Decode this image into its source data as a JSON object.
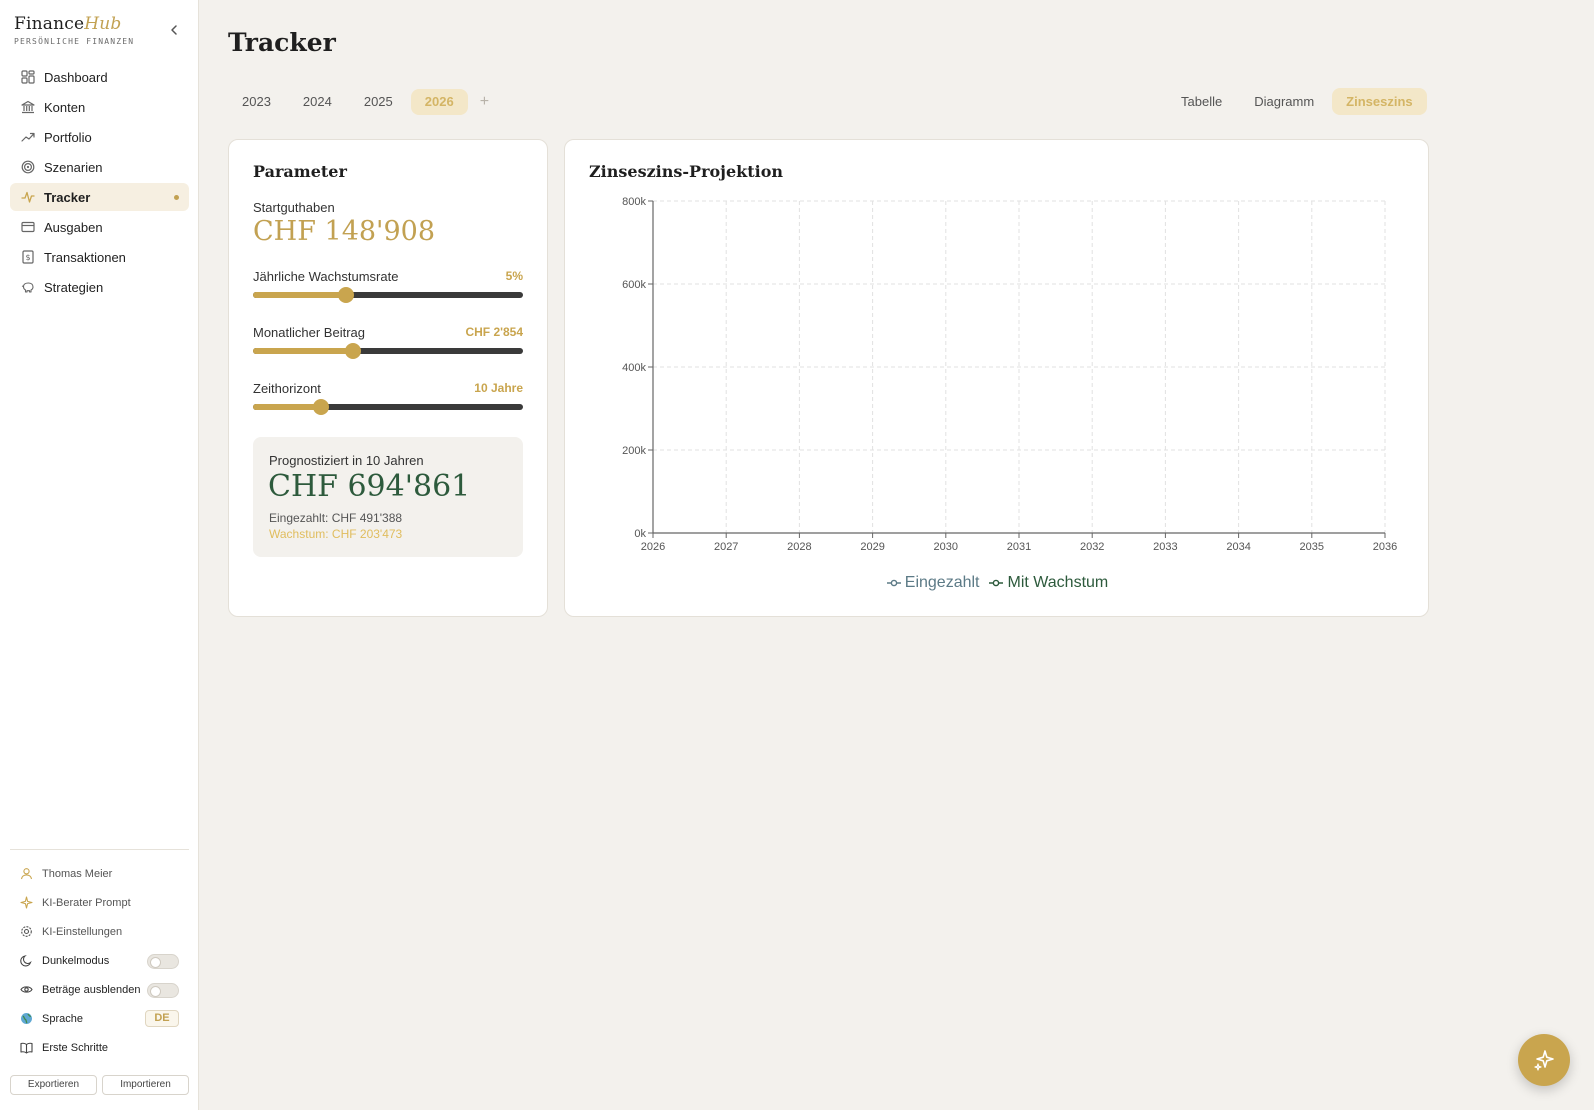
{
  "brand": {
    "name_part1": "Finance",
    "name_part2": "Hub",
    "subtitle": "PERSÖNLICHE FINANZEN"
  },
  "nav": {
    "items": [
      {
        "label": "Dashboard",
        "icon": "dashboard-grid-icon"
      },
      {
        "label": "Konten",
        "icon": "bank-icon"
      },
      {
        "label": "Portfolio",
        "icon": "trend-up-icon"
      },
      {
        "label": "Szenarien",
        "icon": "target-icon"
      },
      {
        "label": "Tracker",
        "icon": "pulse-icon",
        "active": true
      },
      {
        "label": "Ausgaben",
        "icon": "credit-card-icon"
      },
      {
        "label": "Transaktionen",
        "icon": "receipt-icon"
      },
      {
        "label": "Strategien",
        "icon": "piggy-bank-icon"
      }
    ]
  },
  "sidebar_bottom": {
    "user": "Thomas Meier",
    "ai_prompt": "KI-Berater Prompt",
    "ai_settings": "KI-Einstellungen",
    "dark_mode": "Dunkelmodus",
    "hide_amounts": "Beträge ausblenden",
    "language_label": "Sprache",
    "language_value": "DE",
    "getting_started": "Erste Schritte",
    "export": "Exportieren",
    "import": "Importieren"
  },
  "page": {
    "title": "Tracker"
  },
  "year_tabs": {
    "years": [
      "2023",
      "2024",
      "2025",
      "2026"
    ],
    "active": "2026",
    "add": "+"
  },
  "view_tabs": {
    "items": [
      "Tabelle",
      "Diagramm",
      "Zinseszins"
    ],
    "active": "Zinseszins"
  },
  "parameters": {
    "title": "Parameter",
    "start_label": "Startguthaben",
    "start_value": "CHF 148'908",
    "growth": {
      "label": "Jährliche Wachstumsrate",
      "value": "5%",
      "fraction": 0.345
    },
    "monthly": {
      "label": "Monatlicher Beitrag",
      "value": "CHF 2'854",
      "fraction": 0.37
    },
    "horizon": {
      "label": "Zeithorizont",
      "value": "10 Jahre",
      "fraction": 0.25
    },
    "result": {
      "label": "Prognostiziert in 10 Jahren",
      "value": "CHF 694'861",
      "paid": "Eingezahlt: CHF 491'388",
      "growth": "Wachstum: CHF 203'473"
    }
  },
  "colors": {
    "accent": "#c9a54e",
    "green": "#2d5a3c",
    "paid": "#5c7a86"
  },
  "chart_data": {
    "type": "line",
    "title": "Zinseszins-Projektion",
    "x": [
      2026,
      2027,
      2028,
      2029,
      2030,
      2031,
      2032,
      2033,
      2034,
      2035,
      2036
    ],
    "x_tick_labels": [
      "2026",
      "2027",
      "2028",
      "2029",
      "2030",
      "2031",
      "2032",
      "2033",
      "2034",
      "2035",
      "2036"
    ],
    "y_tick_labels": [
      "0k",
      "200k",
      "400k",
      "600k",
      "800k"
    ],
    "ylim": [
      0,
      800000
    ],
    "grid": true,
    "legend_position": "bottom-center",
    "series": [
      {
        "name": "Eingezahlt",
        "values": []
      },
      {
        "name": "Mit Wachstum",
        "values": []
      }
    ]
  }
}
